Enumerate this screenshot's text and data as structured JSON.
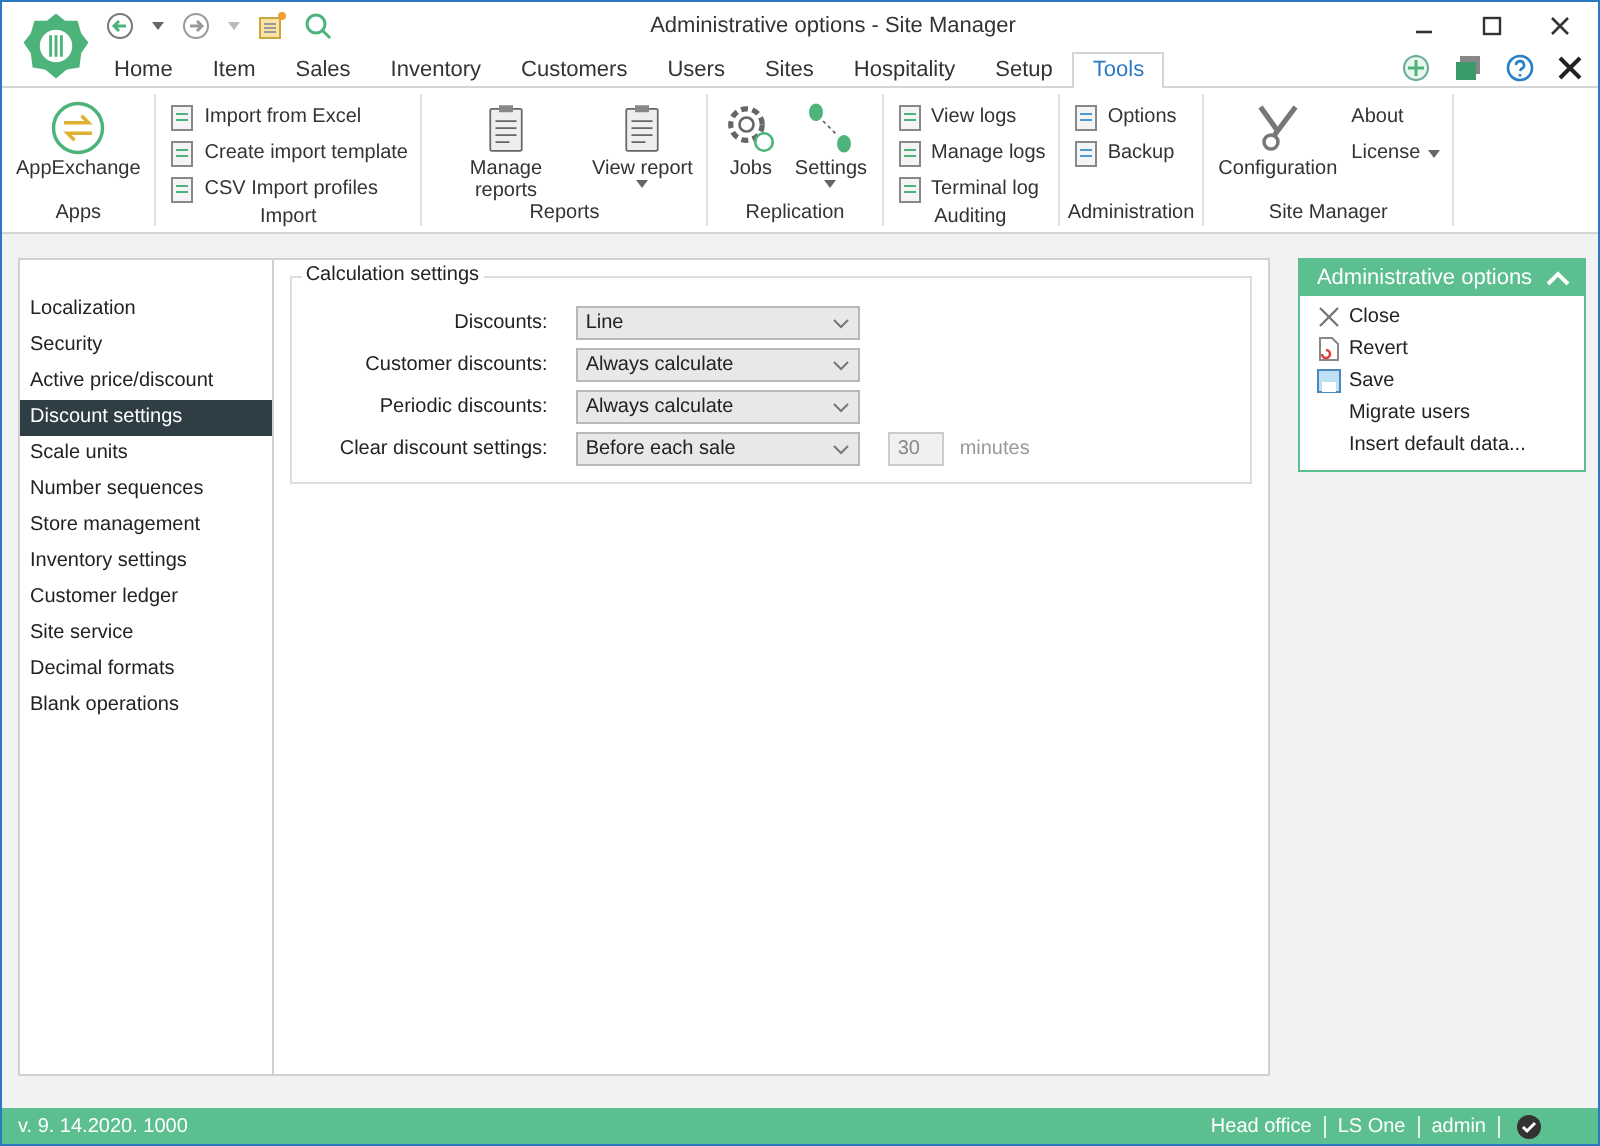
{
  "window": {
    "title": "Administrative options - Site Manager"
  },
  "tabs": [
    {
      "label": "Home",
      "selected": false
    },
    {
      "label": "Item",
      "selected": false
    },
    {
      "label": "Sales",
      "selected": false
    },
    {
      "label": "Inventory",
      "selected": false
    },
    {
      "label": "Customers",
      "selected": false
    },
    {
      "label": "Users",
      "selected": false
    },
    {
      "label": "Sites",
      "selected": false
    },
    {
      "label": "Hospitality",
      "selected": false
    },
    {
      "label": "Setup",
      "selected": false
    },
    {
      "label": "Tools",
      "selected": true
    }
  ],
  "ribbon_groups": [
    {
      "label": "Apps",
      "items": [
        {
          "kind": "large",
          "label": "AppExchange",
          "dropdown": false
        }
      ]
    },
    {
      "label": "Import",
      "items": [
        {
          "kind": "small",
          "label": "Import from Excel",
          "dropdown": false
        },
        {
          "kind": "small",
          "label": "Create import template",
          "dropdown": false
        },
        {
          "kind": "small",
          "label": "CSV Import profiles",
          "dropdown": false
        }
      ]
    },
    {
      "label": "Reports",
      "items": [
        {
          "kind": "large",
          "label": "Manage reports",
          "dropdown": false
        },
        {
          "kind": "large",
          "label": "View report",
          "dropdown": true
        }
      ]
    },
    {
      "label": "Replication",
      "items": [
        {
          "kind": "large",
          "label": "Jobs",
          "dropdown": false
        },
        {
          "kind": "large",
          "label": "Settings",
          "dropdown": true
        }
      ]
    },
    {
      "label": "Auditing",
      "items": [
        {
          "kind": "small",
          "label": "View logs",
          "dropdown": false
        },
        {
          "kind": "small",
          "label": "Manage logs",
          "dropdown": false
        },
        {
          "kind": "small",
          "label": "Terminal log",
          "dropdown": false
        }
      ]
    },
    {
      "label": "Administration",
      "items": [
        {
          "kind": "small",
          "label": "Options",
          "dropdown": false
        },
        {
          "kind": "small",
          "label": "Backup",
          "dropdown": false
        }
      ]
    },
    {
      "label": "Site Manager",
      "items": [
        {
          "kind": "large",
          "label": "Configuration",
          "dropdown": false
        },
        {
          "kind": "text",
          "label": "About",
          "dropdown": false
        },
        {
          "kind": "text",
          "label": "License",
          "dropdown": true
        }
      ]
    }
  ],
  "sidebar": {
    "items": [
      {
        "label": "Localization",
        "selected": false
      },
      {
        "label": "Security",
        "selected": false
      },
      {
        "label": "Active price/discount",
        "selected": false
      },
      {
        "label": "Discount settings",
        "selected": true
      },
      {
        "label": "Scale units",
        "selected": false
      },
      {
        "label": "Number sequences",
        "selected": false
      },
      {
        "label": "Store management",
        "selected": false
      },
      {
        "label": "Inventory settings",
        "selected": false
      },
      {
        "label": "Customer ledger",
        "selected": false
      },
      {
        "label": "Site service",
        "selected": false
      },
      {
        "label": "Decimal formats",
        "selected": false
      },
      {
        "label": "Blank operations",
        "selected": false
      }
    ]
  },
  "calculation_settings": {
    "title": "Calculation settings",
    "rows": [
      {
        "label": "Discounts:",
        "value": "Line"
      },
      {
        "label": "Customer discounts:",
        "value": "Always calculate"
      },
      {
        "label": "Periodic discounts:",
        "value": "Always calculate"
      },
      {
        "label": "Clear discount settings:",
        "value": "Before each sale",
        "extra": {
          "value": "30",
          "unit": "minutes",
          "disabled": true
        }
      }
    ]
  },
  "actions_panel": {
    "title": "Administrative options",
    "expanded": true,
    "items": [
      {
        "label": "Close"
      },
      {
        "label": "Revert"
      },
      {
        "label": "Save"
      },
      {
        "label": "Migrate users"
      },
      {
        "label": "Insert default data..."
      }
    ]
  },
  "status_bar": {
    "version": "v. 9. 14.2020. 1000",
    "items": [
      "Head office",
      "LS One",
      "admin"
    ]
  }
}
